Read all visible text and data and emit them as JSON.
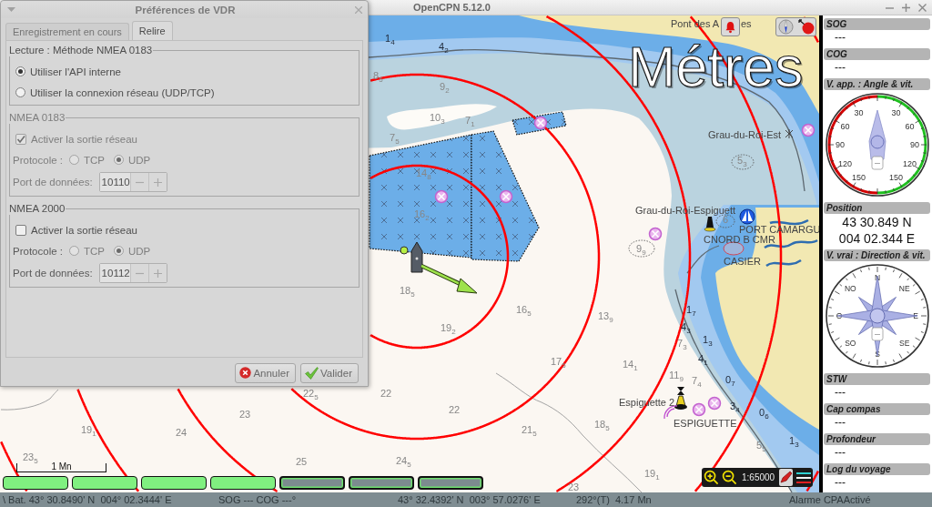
{
  "window": {
    "title": "OpenCPN 5.12.0"
  },
  "dialog": {
    "title": "Préférences de VDR",
    "tabs": [
      {
        "label": "Enregistrement en cours",
        "selected": false
      },
      {
        "label": "Relire",
        "selected": true
      }
    ],
    "groups": [
      {
        "legend": "Lecture : Méthode NMEA 0183",
        "disabled": false,
        "rows": [
          {
            "kind": "radio",
            "label": "Utiliser l'API interne",
            "selected": true,
            "disabled": false
          },
          {
            "kind": "radio",
            "label": "Utiliser la connexion réseau (UDP/TCP)",
            "selected": false,
            "disabled": false
          }
        ]
      },
      {
        "legend": "NMEA 0183",
        "disabled": true,
        "rows": [
          {
            "kind": "checkbox",
            "label": "Activer la sortie réseau",
            "checked": true,
            "disabled": true
          },
          {
            "kind": "protocol",
            "label": "Protocole :",
            "disabled": true,
            "options": [
              {
                "label": "TCP",
                "selected": false,
                "disabled": true
              },
              {
                "label": "UDP",
                "selected": true,
                "disabled": true
              }
            ]
          },
          {
            "kind": "spin",
            "label": "Port de données:",
            "disabled": true,
            "value": "10110",
            "field_disabled": true
          }
        ]
      },
      {
        "legend": "NMEA 2000",
        "disabled": false,
        "rows": [
          {
            "kind": "checkbox",
            "label": "Activer la sortie réseau",
            "checked": false,
            "disabled": false
          },
          {
            "kind": "protocol",
            "label": "Protocole :",
            "disabled": false,
            "options": [
              {
                "label": "TCP",
                "selected": false,
                "disabled": true
              },
              {
                "label": "UDP",
                "selected": true,
                "disabled": true
              }
            ]
          },
          {
            "kind": "spin",
            "label": "Port de données:",
            "disabled": false,
            "value": "10112",
            "field_disabled": true
          }
        ]
      }
    ],
    "buttons": [
      {
        "kind": "cancel",
        "label": "Annuler"
      },
      {
        "kind": "ok",
        "label": "Valider"
      }
    ]
  },
  "map": {
    "depth_units": "Métres",
    "place_labels": [
      "Pont des A",
      "es",
      "Grau-du-Roi-Est",
      "Grau-du-Roi-Espiguett",
      "PORT CAMARGU",
      "CNORD B CMR",
      "CASIER",
      "Espiguette 2",
      "ESPIGUETTE"
    ],
    "soundings": [
      {
        "text": "1$_{4}$",
        "shallow": true
      },
      {
        "text": "4$_{2}$",
        "shallow": true
      },
      {
        "text": "8$_{5}$",
        "shallow": false
      },
      {
        "text": "9$_{2}$",
        "shallow": false
      },
      {
        "text": "10$_{3}$",
        "shallow": false
      },
      {
        "text": "7$_{1}$",
        "shallow": false
      },
      {
        "text": "7$_{5}$",
        "shallow": false
      },
      {
        "text": "5$_{3}$",
        "shallow": false
      },
      {
        "text": "14$_{8}$",
        "shallow": false
      },
      {
        "text": "16$_{2}$",
        "shallow": false
      },
      {
        "text": "6",
        "shallow": false
      },
      {
        "text": "9$_{9}$",
        "shallow": false
      },
      {
        "text": "18$_{5}$",
        "shallow": false
      },
      {
        "text": "16$_{5}$",
        "shallow": false
      },
      {
        "text": "13$_{9}$",
        "shallow": false
      },
      {
        "text": "1$_{7}$",
        "shallow": true
      },
      {
        "text": "19$_{2}$",
        "shallow": false
      },
      {
        "text": "4$_{3}$",
        "shallow": true
      },
      {
        "text": "7$_{3}$",
        "shallow": false
      },
      {
        "text": "1$_{3}$",
        "shallow": true
      },
      {
        "text": "17$_{5}$",
        "shallow": false
      },
      {
        "text": "14$_{1}$",
        "shallow": false
      },
      {
        "text": "4$_{1}$",
        "shallow": true
      },
      {
        "text": "11$_{9}$",
        "shallow": false
      },
      {
        "text": "7$_{4}$",
        "shallow": false
      },
      {
        "text": "0$_{7}$",
        "shallow": true
      },
      {
        "text": "22$_{5}$",
        "shallow": false
      },
      {
        "text": "22",
        "shallow": false
      },
      {
        "text": "23",
        "shallow": false
      },
      {
        "text": "22",
        "shallow": false
      },
      {
        "text": "3$_{4}$",
        "shallow": true
      },
      {
        "text": "0$_{6}$",
        "shallow": true
      },
      {
        "text": "19$_{1}$",
        "shallow": false
      },
      {
        "text": "24",
        "shallow": false
      },
      {
        "text": "21$_{5}$",
        "shallow": false
      },
      {
        "text": "18$_{5}$",
        "shallow": false
      },
      {
        "text": "5$_{5}$",
        "shallow": false
      },
      {
        "text": "1$_{3}$",
        "shallow": true
      },
      {
        "text": "23$_{5}$",
        "shallow": false
      },
      {
        "text": "25",
        "shallow": false
      },
      {
        "text": "24$_{5}$",
        "shallow": false
      },
      {
        "text": "19$_{1}$",
        "shallow": false
      },
      {
        "text": "23",
        "shallow": false
      }
    ],
    "scale_bar": "1 Mn",
    "chart_bar": [
      {
        "active": true
      },
      {
        "active": true
      },
      {
        "active": true
      },
      {
        "active": true
      },
      {
        "active": false
      },
      {
        "active": false
      },
      {
        "active": false
      }
    ],
    "zoom_scale": "1:65000"
  },
  "instruments": [
    {
      "kind": "value",
      "title": "SOG",
      "value": "---"
    },
    {
      "kind": "value",
      "title": "COG",
      "value": "---"
    },
    {
      "kind": "wind_dial",
      "title": "V. app. : Angle & vit.",
      "left_labels": [
        "30",
        "60",
        "90",
        "120",
        "150"
      ],
      "right_labels": [
        "30",
        "60",
        "90",
        "120",
        "150"
      ],
      "readout": "---"
    },
    {
      "kind": "position",
      "title": "Position",
      "lines": [
        "43 30.849 N",
        "004 02.344 E"
      ]
    },
    {
      "kind": "compass",
      "title": "V. vrai : Direction & vit.",
      "labels": [
        "N",
        "NE",
        "E",
        "SE",
        "S",
        "SO",
        "O",
        "NO"
      ],
      "readout": "---"
    },
    {
      "kind": "value",
      "title": "STW",
      "value": "---"
    },
    {
      "kind": "value",
      "title": "Cap compas",
      "value": "---"
    },
    {
      "kind": "value",
      "title": "Profondeur",
      "value": "---"
    },
    {
      "kind": "value",
      "title": "Log du voyage",
      "value": "---"
    }
  ],
  "status_bar": [
    "\\ Bat. 43° 30.8490' N  004° 02.3444' E",
    "SOG --- COG ---°",
    "43° 32.4392' N  003° 57.0276' E",
    "292°(T)  4.17 Mn",
    "Alarme CPAActivé"
  ]
}
